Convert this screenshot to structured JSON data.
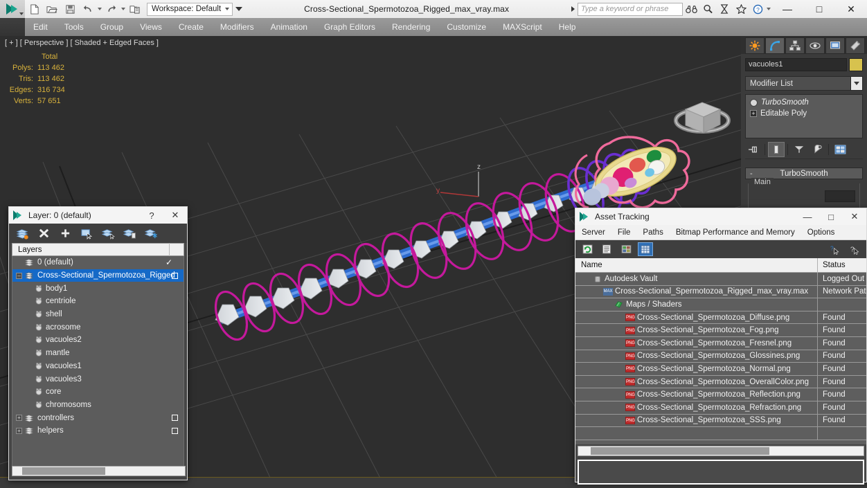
{
  "titlebar": {
    "document_title": "Cross-Sectional_Spermotozoa_Rigged_max_vray.max",
    "workspace_label": "Workspace: Default",
    "search_placeholder": "Type a keyword or phrase",
    "qat": [
      {
        "name": "new-file-icon",
        "label": "New"
      },
      {
        "name": "open-file-icon",
        "label": "Open"
      },
      {
        "name": "save-file-icon",
        "label": "Save"
      },
      {
        "name": "undo-icon",
        "label": "Undo"
      },
      {
        "name": "redo-icon",
        "label": "Redo"
      },
      {
        "name": "project-folder-icon",
        "label": "Set Project Folder"
      }
    ],
    "tools": [
      {
        "name": "binoculars-icon",
        "label": "Search"
      },
      {
        "name": "magnifier-icon",
        "label": "Find"
      },
      {
        "name": "hourglass-icon",
        "label": "Busy"
      },
      {
        "name": "star-icon",
        "label": "Favorites"
      },
      {
        "name": "help-icon",
        "label": "Help"
      }
    ],
    "window_buttons": {
      "minimize": "—",
      "maximize": "□",
      "close": "✕"
    }
  },
  "menubar": {
    "items": [
      "Edit",
      "Tools",
      "Group",
      "Views",
      "Create",
      "Modifiers",
      "Animation",
      "Graph Editors",
      "Rendering",
      "Customize",
      "MAXScript",
      "Help"
    ]
  },
  "viewport": {
    "label": "[ + ] [ Perspective ] [ Shaded + Edged Faces ]",
    "stats": {
      "header": "Total",
      "rows": [
        {
          "label": "Polys:",
          "value": "113 462"
        },
        {
          "label": "Tris:",
          "value": "113 462"
        },
        {
          "label": "Edges:",
          "value": "316 734"
        },
        {
          "label": "Verts:",
          "value": "57 651"
        }
      ]
    },
    "axis_gizmo": {
      "z_label": "z",
      "y_label": "y"
    },
    "colors": {
      "background": "#2e2e2e",
      "spline_magenta": "#c4199c",
      "spline_purple": "#6a2fd0",
      "spline_pink": "#ef6a9b",
      "helper_blue": "#2e6fd8",
      "stats_yellow": "#d8b23c"
    }
  },
  "command_panel": {
    "tabs": [
      {
        "name": "create-tab",
        "label": "Create",
        "active": false
      },
      {
        "name": "modify-tab",
        "label": "Modify",
        "active": true
      },
      {
        "name": "hierarchy-tab",
        "label": "Hierarchy",
        "active": false
      },
      {
        "name": "motion-tab",
        "label": "Motion",
        "active": false
      },
      {
        "name": "display-tab",
        "label": "Display",
        "active": false
      },
      {
        "name": "utilities-tab",
        "label": "Utilities",
        "active": false
      }
    ],
    "object_name": "vacuoles1",
    "object_color": "#d7c24e",
    "modifier_list_label": "Modifier List",
    "modifier_stack": [
      {
        "label": "TurboSmooth",
        "italic": true
      },
      {
        "label": "Editable Poly",
        "italic": false
      }
    ],
    "stack_buttons": [
      {
        "name": "pin-stack-icon",
        "label": "Pin Stack"
      },
      {
        "name": "show-end-result-icon",
        "label": "Show End Result"
      },
      {
        "name": "make-unique-icon",
        "label": "Make Unique"
      },
      {
        "name": "remove-modifier-icon",
        "label": "Remove Modifier"
      },
      {
        "name": "configure-modifier-sets-icon",
        "label": "Configure Modifier Sets"
      }
    ],
    "rollout": {
      "title": "TurboSmooth",
      "collapse_symbol": "-",
      "group_label": "Main"
    }
  },
  "layer_dialog": {
    "title": "Layer: 0 (default)",
    "help_button": "?",
    "close_button": "✕",
    "toolbar": [
      {
        "name": "create-new-layer-icon",
        "label": "Create New Layer"
      },
      {
        "name": "delete-layer-icon",
        "label": "Delete Highlighted Empty Layers"
      },
      {
        "name": "add-selection-to-layer-icon",
        "label": "Add Selection to Highlighted Layer"
      },
      {
        "name": "select-objects-in-layer-icon",
        "label": "Select Objects in Highlighted Layers"
      },
      {
        "name": "highlight-selected-objects-layer-icon",
        "label": "Highlight Selected Objects' Layers"
      },
      {
        "name": "hide-layer-icon",
        "label": "Hide/Unhide"
      },
      {
        "name": "freeze-layer-icon",
        "label": "Freeze/Unfreeze"
      }
    ],
    "column_header": "Layers",
    "rows": [
      {
        "name": "0 (default)",
        "type": "layer",
        "indent": 0,
        "expandable": false,
        "selected": false,
        "current": true,
        "hidebox": false
      },
      {
        "name": "Cross-Sectional_Spermotozoa_Rigged",
        "type": "layer",
        "indent": 0,
        "expandable": true,
        "expanded": true,
        "selected": true,
        "current": false,
        "hidebox": true
      },
      {
        "name": "body1",
        "type": "object",
        "indent": 1,
        "selected": false
      },
      {
        "name": "centriole",
        "type": "object",
        "indent": 1,
        "selected": false
      },
      {
        "name": "shell",
        "type": "object",
        "indent": 1,
        "selected": false
      },
      {
        "name": "acrosome",
        "type": "object",
        "indent": 1,
        "selected": false
      },
      {
        "name": "vacuoles2",
        "type": "object",
        "indent": 1,
        "selected": false
      },
      {
        "name": "mantle",
        "type": "object",
        "indent": 1,
        "selected": false
      },
      {
        "name": "vacuoles1",
        "type": "object",
        "indent": 1,
        "selected": false
      },
      {
        "name": "vacuoles3",
        "type": "object",
        "indent": 1,
        "selected": false
      },
      {
        "name": "core",
        "type": "object",
        "indent": 1,
        "selected": false
      },
      {
        "name": "chromosoms",
        "type": "object",
        "indent": 1,
        "selected": false
      },
      {
        "name": "controllers",
        "type": "layer",
        "indent": 0,
        "expandable": true,
        "expanded": false,
        "selected": false,
        "current": false,
        "hidebox": true
      },
      {
        "name": "helpers",
        "type": "layer",
        "indent": 0,
        "expandable": true,
        "expanded": false,
        "selected": false,
        "current": false,
        "hidebox": true
      }
    ],
    "selection_color": "#1569c7"
  },
  "asset_dialog": {
    "title": "Asset Tracking",
    "window_buttons": {
      "minimize": "—",
      "maximize": "□",
      "close": "✕"
    },
    "menu": [
      "Server",
      "File",
      "Paths",
      "Bitmap Performance and Memory",
      "Options"
    ],
    "toolbar": [
      {
        "name": "refresh-icon",
        "label": "Refresh",
        "active": false
      },
      {
        "name": "list-view-icon",
        "label": "List View",
        "active": false
      },
      {
        "name": "thumbnail-view-icon",
        "label": "Thumbnail View",
        "active": false
      },
      {
        "name": "grid-view-icon",
        "label": "Grid View",
        "active": true
      }
    ],
    "toolbar_right": [
      {
        "name": "help-pointer-icon",
        "label": "Help Pointer"
      },
      {
        "name": "help-question-icon",
        "label": "Help"
      }
    ],
    "columns": [
      "Name",
      "Status"
    ],
    "rows": [
      {
        "name": "Autodesk Vault",
        "status": "Logged Out",
        "icon": "vault-icon",
        "indent": 1
      },
      {
        "name": "Cross-Sectional_Spermotozoa_Rigged_max_vray.max",
        "status": "Network Pat",
        "icon": "max-file-icon",
        "indent": 2
      },
      {
        "name": "Maps / Shaders",
        "status": "",
        "icon": "maps-shaders-icon",
        "indent": 3
      },
      {
        "name": "Cross-Sectional_Spermotozoa_Diffuse.png",
        "status": "Found",
        "icon": "png-file-icon",
        "indent": 4
      },
      {
        "name": "Cross-Sectional_Spermotozoa_Fog.png",
        "status": "Found",
        "icon": "png-file-icon",
        "indent": 4
      },
      {
        "name": "Cross-Sectional_Spermotozoa_Fresnel.png",
        "status": "Found",
        "icon": "png-file-icon",
        "indent": 4
      },
      {
        "name": "Cross-Sectional_Spermotozoa_Glossines.png",
        "status": "Found",
        "icon": "png-file-icon",
        "indent": 4
      },
      {
        "name": "Cross-Sectional_Spermotozoa_Normal.png",
        "status": "Found",
        "icon": "png-file-icon",
        "indent": 4
      },
      {
        "name": "Cross-Sectional_Spermotozoa_OverallColor.png",
        "status": "Found",
        "icon": "png-file-icon",
        "indent": 4
      },
      {
        "name": "Cross-Sectional_Spermotozoa_Reflection.png",
        "status": "Found",
        "icon": "png-file-icon",
        "indent": 4
      },
      {
        "name": "Cross-Sectional_Spermotozoa_Refraction.png",
        "status": "Found",
        "icon": "png-file-icon",
        "indent": 4
      },
      {
        "name": "Cross-Sectional_Spermotozoa_SSS.png",
        "status": "Found",
        "icon": "png-file-icon",
        "indent": 4
      }
    ],
    "png_badge": "PNG",
    "max_badge": "MAX"
  }
}
